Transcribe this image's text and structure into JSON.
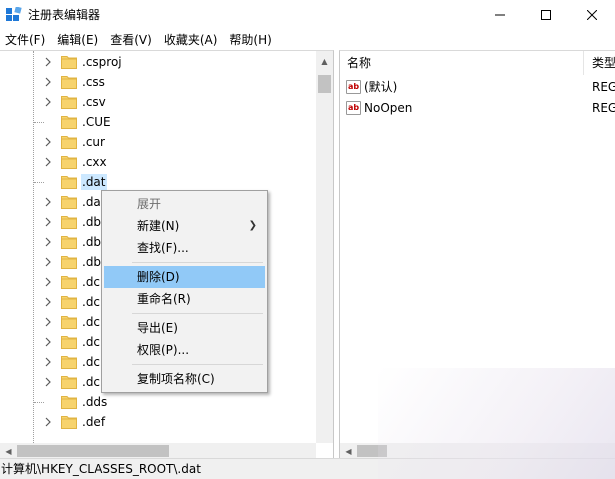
{
  "window": {
    "title": "注册表编辑器",
    "controls": {
      "minimize": "minimize",
      "maximize": "maximize",
      "close": "close"
    }
  },
  "menubar": {
    "items": [
      {
        "label": "文件(F)"
      },
      {
        "label": "编辑(E)"
      },
      {
        "label": "查看(V)"
      },
      {
        "label": "收藏夹(A)"
      },
      {
        "label": "帮助(H)"
      }
    ]
  },
  "tree": {
    "items": [
      {
        "label": ".csproj",
        "expandable": true
      },
      {
        "label": ".css",
        "expandable": true
      },
      {
        "label": ".csv",
        "expandable": true
      },
      {
        "label": ".CUE",
        "expandable": false
      },
      {
        "label": ".cur",
        "expandable": true
      },
      {
        "label": ".cxx",
        "expandable": true
      },
      {
        "label": ".dat",
        "expandable": false,
        "selected": true
      },
      {
        "label": ".dat",
        "expandable": true
      },
      {
        "label": ".db",
        "expandable": true
      },
      {
        "label": ".db",
        "expandable": true
      },
      {
        "label": ".db",
        "expandable": true
      },
      {
        "label": ".dc",
        "expandable": true
      },
      {
        "label": ".dc",
        "expandable": true
      },
      {
        "label": ".dc",
        "expandable": true
      },
      {
        "label": ".dc",
        "expandable": true
      },
      {
        "label": ".dc",
        "expandable": true
      },
      {
        "label": ".dc",
        "expandable": true
      },
      {
        "label": ".dds",
        "expandable": false
      },
      {
        "label": ".def",
        "expandable": true
      }
    ]
  },
  "list": {
    "columns": {
      "name": "名称",
      "type": "类型"
    },
    "rows": [
      {
        "icon": "ab",
        "name": "(默认)",
        "type": "REG"
      },
      {
        "icon": "ab",
        "name": "NoOpen",
        "type": "REG"
      }
    ]
  },
  "context_menu": {
    "items": [
      {
        "label": "展开",
        "disabled": true
      },
      {
        "label": "新建(N)",
        "submenu": true
      },
      {
        "label": "查找(F)..."
      },
      {
        "label": "删除(D)",
        "highlighted": true
      },
      {
        "label": "重命名(R)"
      },
      {
        "label": "导出(E)"
      },
      {
        "label": "权限(P)..."
      },
      {
        "label": "复制项名称(C)"
      }
    ]
  },
  "status": {
    "path": "计算机\\HKEY_CLASSES_ROOT\\.dat"
  },
  "colors": {
    "selection": "#cce8ff",
    "menu_highlight": "#91c9f7",
    "folder": "#f7d36d",
    "folder_edge": "#e0b443"
  }
}
